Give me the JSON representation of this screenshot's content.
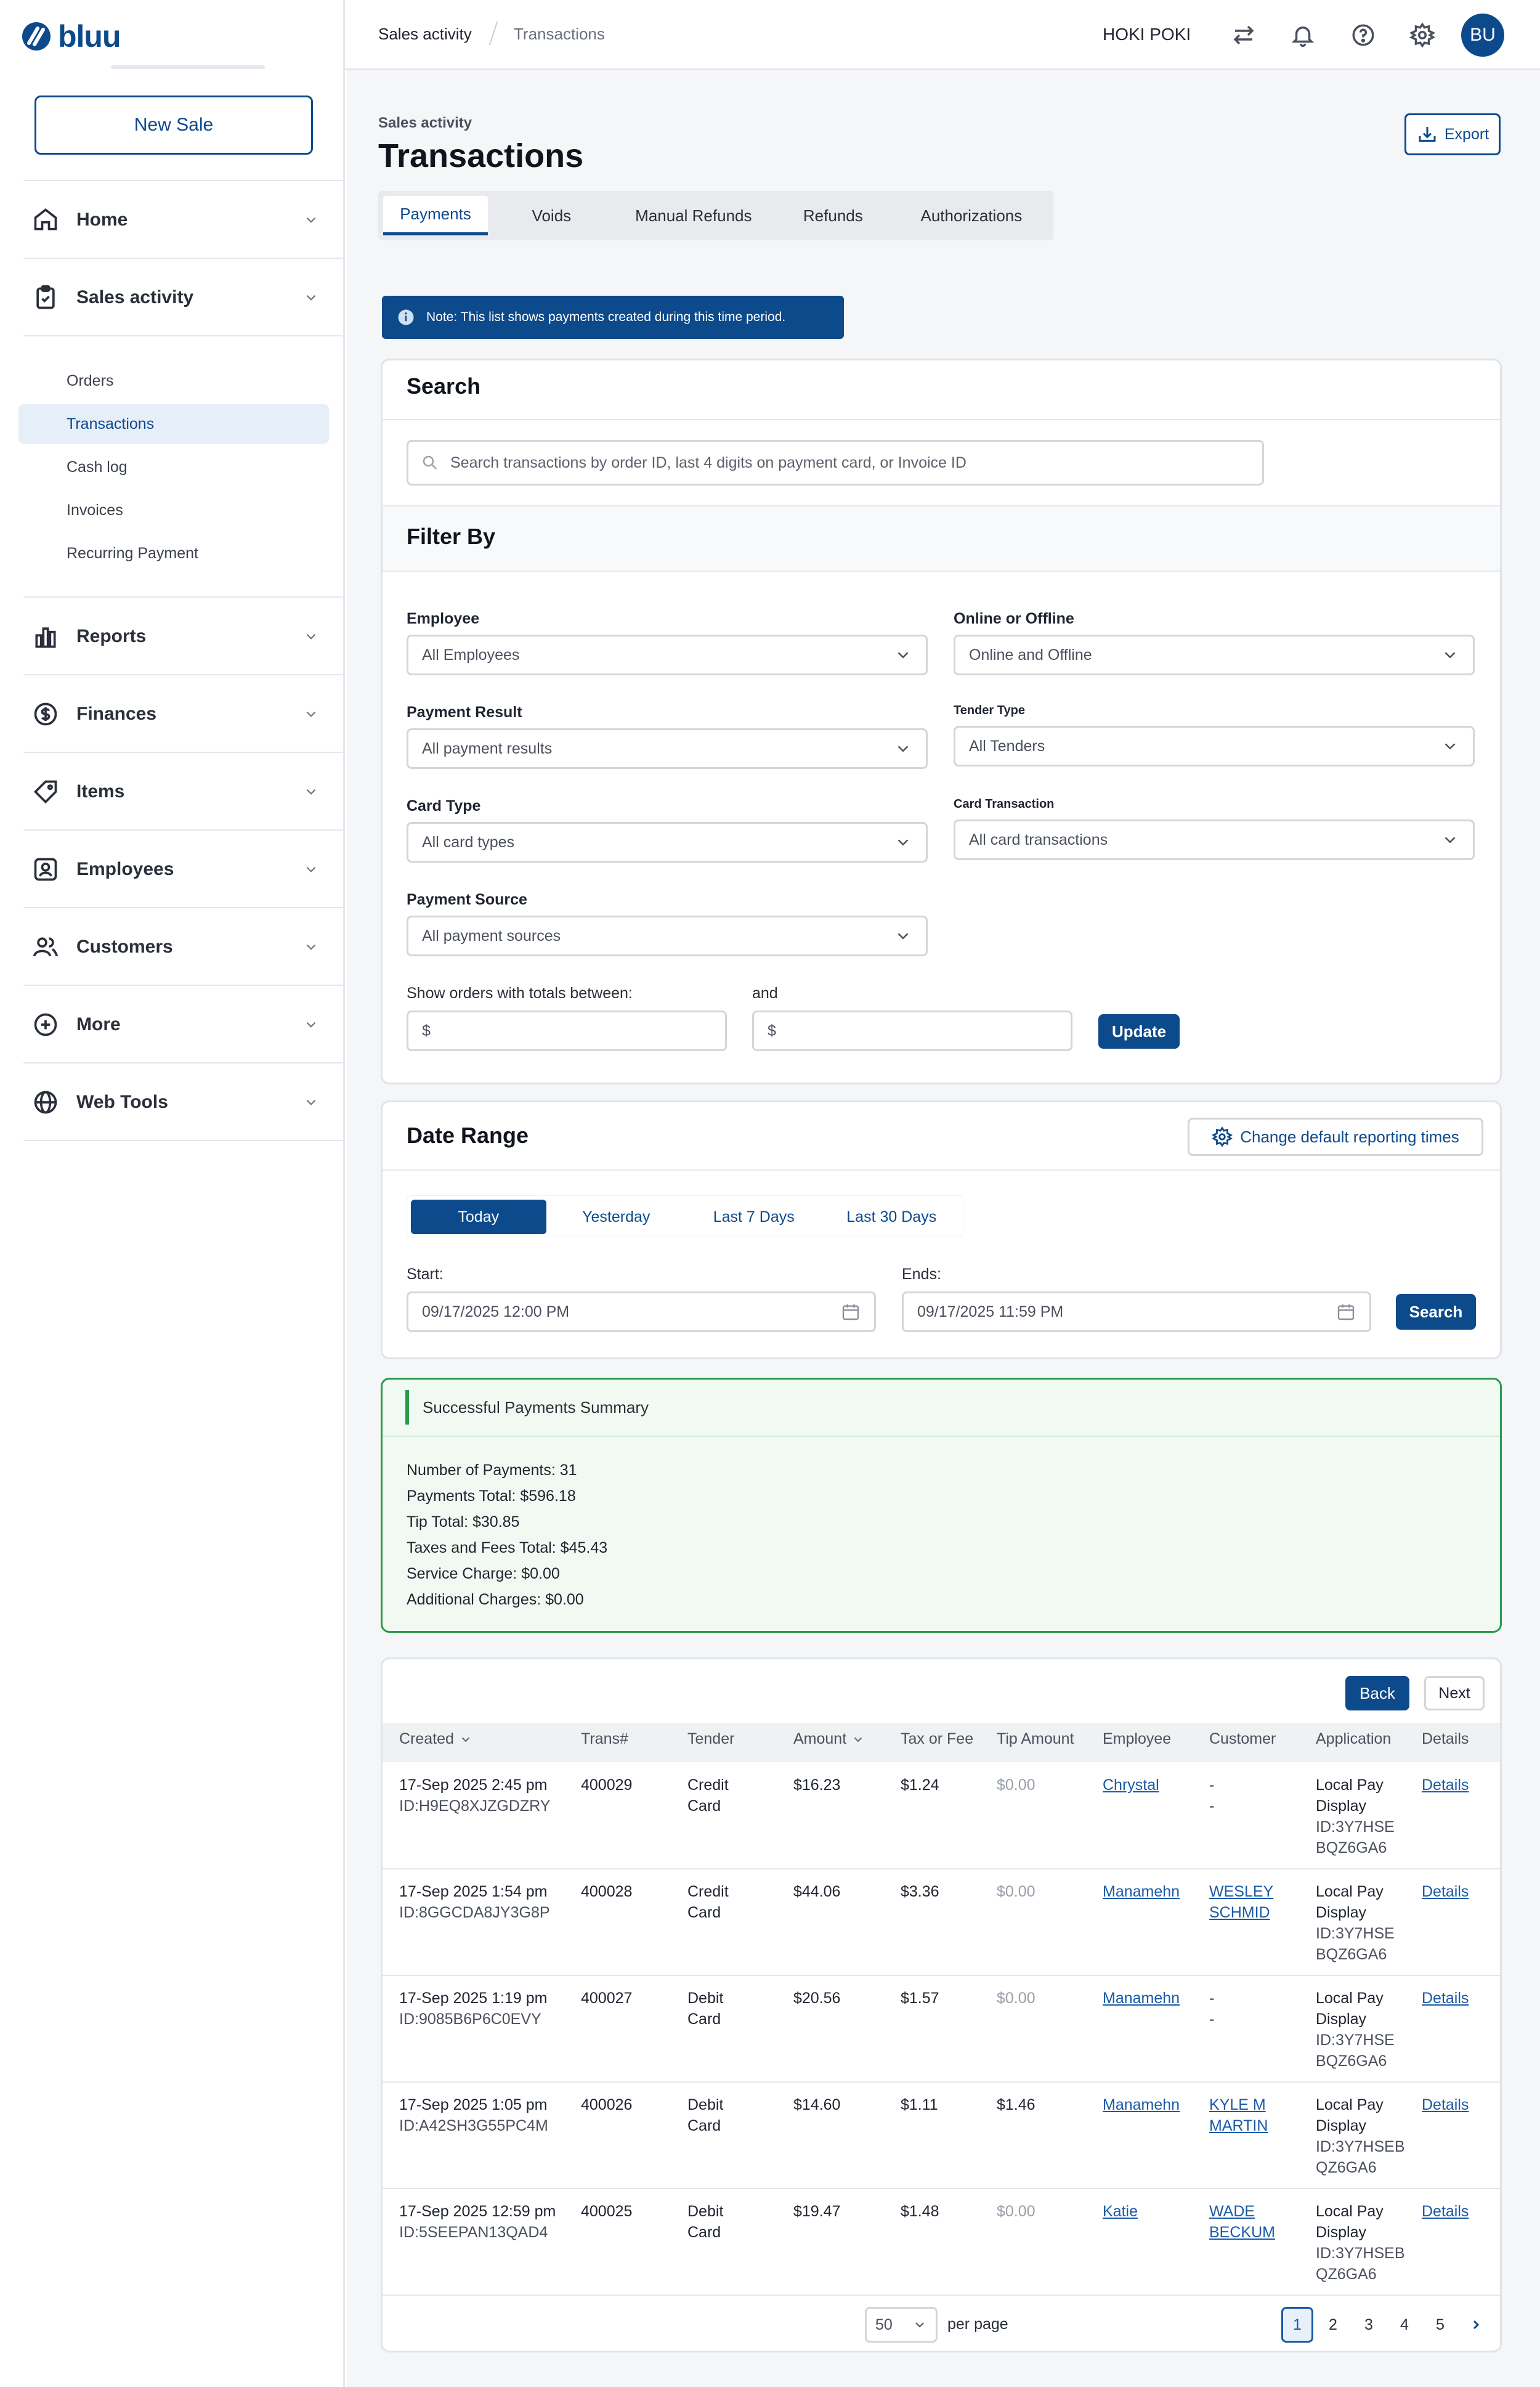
{
  "brand": {
    "name": "bluu",
    "color": "#0d4a8c"
  },
  "sidebar": {
    "new_sale": "New Sale",
    "nav": [
      {
        "label": "Home",
        "icon": "home-icon"
      },
      {
        "label": "Sales activity",
        "icon": "clipboard-icon"
      },
      {
        "label": "Reports",
        "icon": "bar-chart-icon"
      },
      {
        "label": "Finances",
        "icon": "dollar-circle-icon"
      },
      {
        "label": "Items",
        "icon": "tag-icon"
      },
      {
        "label": "Employees",
        "icon": "id-badge-icon"
      },
      {
        "label": "Customers",
        "icon": "users-icon"
      },
      {
        "label": "More",
        "icon": "plus-circle-icon"
      },
      {
        "label": "Web Tools",
        "icon": "globe-icon"
      }
    ],
    "sales_sub": [
      {
        "label": "Orders"
      },
      {
        "label": "Transactions",
        "active": true
      },
      {
        "label": "Cash log"
      },
      {
        "label": "Invoices"
      },
      {
        "label": "Recurring Payment"
      }
    ]
  },
  "topbar": {
    "breadcrumb": [
      "Sales activity",
      "Transactions"
    ],
    "store": "HOKI POKI",
    "avatar": "BU"
  },
  "page": {
    "eyebrow": "Sales activity",
    "title": "Transactions",
    "export": "Export",
    "tabs": [
      "Payments",
      "Voids",
      "Manual Refunds",
      "Refunds",
      "Authorizations"
    ],
    "note": "Note: This list shows payments created during this time period."
  },
  "search": {
    "title": "Search",
    "placeholder": "Search transactions by order ID, last 4 digits on payment card, or Invoice ID"
  },
  "filter": {
    "title": "Filter By",
    "employee": {
      "label": "Employee",
      "value": "All Employees"
    },
    "online": {
      "label": "Online or Offline",
      "value": "Online and Offline"
    },
    "payment_result": {
      "label": "Payment Result",
      "value": "All payment results"
    },
    "tender_type": {
      "label": "Tender Type",
      "value": "All Tenders"
    },
    "card_type": {
      "label": "Card Type",
      "value": "All card types"
    },
    "card_transaction": {
      "label": "Card Transaction",
      "value": "All card transactions"
    },
    "payment_source": {
      "label": "Payment Source",
      "value": "All payment sources"
    },
    "totals_label": "Show orders with totals between:",
    "and_label": "and",
    "min_placeholder": "$",
    "max_placeholder": "$",
    "update": "Update"
  },
  "date_range": {
    "title": "Date Range",
    "change_default": "Change default reporting times",
    "presets": [
      "Today",
      "Yesterday",
      "Last 7 Days",
      "Last 30 Days"
    ],
    "start_label": "Start:",
    "start_value": "09/17/2025 12:00 PM",
    "end_label": "Ends:",
    "end_value": "09/17/2025 11:59 PM",
    "search": "Search"
  },
  "summary": {
    "title": "Successful Payments Summary",
    "lines": [
      "Number of Payments: 31",
      "Payments Total: $596.18",
      "Tip Total: $30.85",
      "Taxes and Fees Total: $45.43",
      "Service Charge: $0.00",
      "Additional Charges: $0.00"
    ]
  },
  "table": {
    "back": "Back",
    "next": "Next",
    "headers": [
      "Created",
      "Trans#",
      "Tender",
      "Amount",
      "Tax or Fee",
      "Tip Amount",
      "Employee",
      "Customer",
      "Application",
      "Details"
    ],
    "rows": [
      {
        "created": "17-Sep 2025 2:45 pm",
        "id": "ID:H9EQ8XJZGDZRY",
        "trans": "400029",
        "tender1": "Credit",
        "tender2": "Card",
        "amount": "$16.23",
        "tax": "$1.24",
        "tip": "$0.00",
        "employee": "Chrystal",
        "cust1": "-",
        "cust2": "-",
        "app1": "Local Pay",
        "app2": "Display",
        "app3": "ID:3Y7HSE",
        "app4": "BQZ6GA6",
        "details": "Details"
      },
      {
        "created": "17-Sep 2025 1:54 pm",
        "id": "ID:8GGCDA8JY3G8P",
        "trans": "400028",
        "tender1": "Credit",
        "tender2": "Card",
        "amount": "$44.06",
        "tax": "$3.36",
        "tip": "$0.00",
        "employee": "Manamehn",
        "cust1": "WESLEY",
        "cust2": "SCHMID",
        "app1": "Local Pay",
        "app2": "Display",
        "app3": "ID:3Y7HSE",
        "app4": "BQZ6GA6",
        "details": "Details"
      },
      {
        "created": "17-Sep 2025 1:19 pm",
        "id": "ID:9085B6P6C0EVY",
        "trans": "400027",
        "tender1": "Debit",
        "tender2": "Card",
        "amount": "$20.56",
        "tax": "$1.57",
        "tip": "$0.00",
        "employee": "Manamehn",
        "cust1": "-",
        "cust2": "-",
        "app1": "Local Pay",
        "app2": "Display",
        "app3": "ID:3Y7HSE",
        "app4": "BQZ6GA6",
        "details": "Details"
      },
      {
        "created": "17-Sep 2025 1:05 pm",
        "id": "ID:A42SH3G55PC4M",
        "trans": "400026",
        "tender1": "Debit",
        "tender2": "Card",
        "amount": "$14.60",
        "tax": "$1.11",
        "tip": "$1.46",
        "employee": "Manamehn",
        "cust1": "KYLE M",
        "cust2": "MARTIN",
        "app1": "Local Pay",
        "app2": "Display",
        "app3": "ID:3Y7HSEB",
        "app4": "QZ6GA6",
        "details": "Details"
      },
      {
        "created": "17-Sep 2025 12:59 pm",
        "id": "ID:5SEEPAN13QAD4",
        "trans": "400025",
        "tender1": "Debit",
        "tender2": "Card",
        "amount": "$19.47",
        "tax": "$1.48",
        "tip": "$0.00",
        "employee": "Katie",
        "cust1": "WADE",
        "cust2": "BECKUM",
        "app1": "Local Pay",
        "app2": "Display",
        "app3": "ID:3Y7HSEB",
        "app4": "QZ6GA6",
        "details": "Details"
      }
    ],
    "per_page_value": "50",
    "per_page_label": "per page",
    "pages": [
      "1",
      "2",
      "3",
      "4",
      "5"
    ],
    "current_page": "1"
  }
}
